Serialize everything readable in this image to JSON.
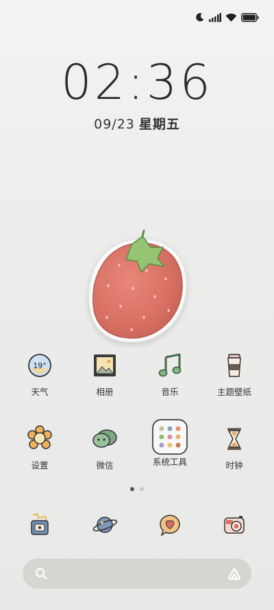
{
  "status_bar": {
    "icons": [
      "moon-icon",
      "signal-icon",
      "wifi-icon",
      "battery-icon"
    ]
  },
  "clock": {
    "time": "02:36",
    "date": "09/23",
    "weekday": "星期五"
  },
  "widget": {
    "name": "strawberry-widget"
  },
  "apps_row1": [
    {
      "label": "天气",
      "icon": "weather-icon",
      "temp": "19°"
    },
    {
      "label": "相册",
      "icon": "gallery-icon"
    },
    {
      "label": "音乐",
      "icon": "music-icon"
    },
    {
      "label": "主题壁纸",
      "icon": "themes-icon"
    }
  ],
  "apps_row2": [
    {
      "label": "设置",
      "icon": "settings-icon"
    },
    {
      "label": "微信",
      "icon": "wechat-icon"
    },
    {
      "label": "系统工具",
      "icon": "system-tools-folder-icon"
    },
    {
      "label": "时钟",
      "icon": "clock-icon"
    }
  ],
  "page_indicator": {
    "count": 2,
    "active": 1
  },
  "dock": [
    {
      "icon": "phone-icon"
    },
    {
      "icon": "browser-icon"
    },
    {
      "icon": "messages-icon"
    },
    {
      "icon": "camera-icon"
    }
  ],
  "search": {
    "placeholder": "",
    "left_icon": "search-icon",
    "right_icon": "assistant-icon"
  },
  "colors": {
    "background": "#ededec",
    "strawberry": "#d9776a",
    "leaf": "#8fbf6a"
  }
}
